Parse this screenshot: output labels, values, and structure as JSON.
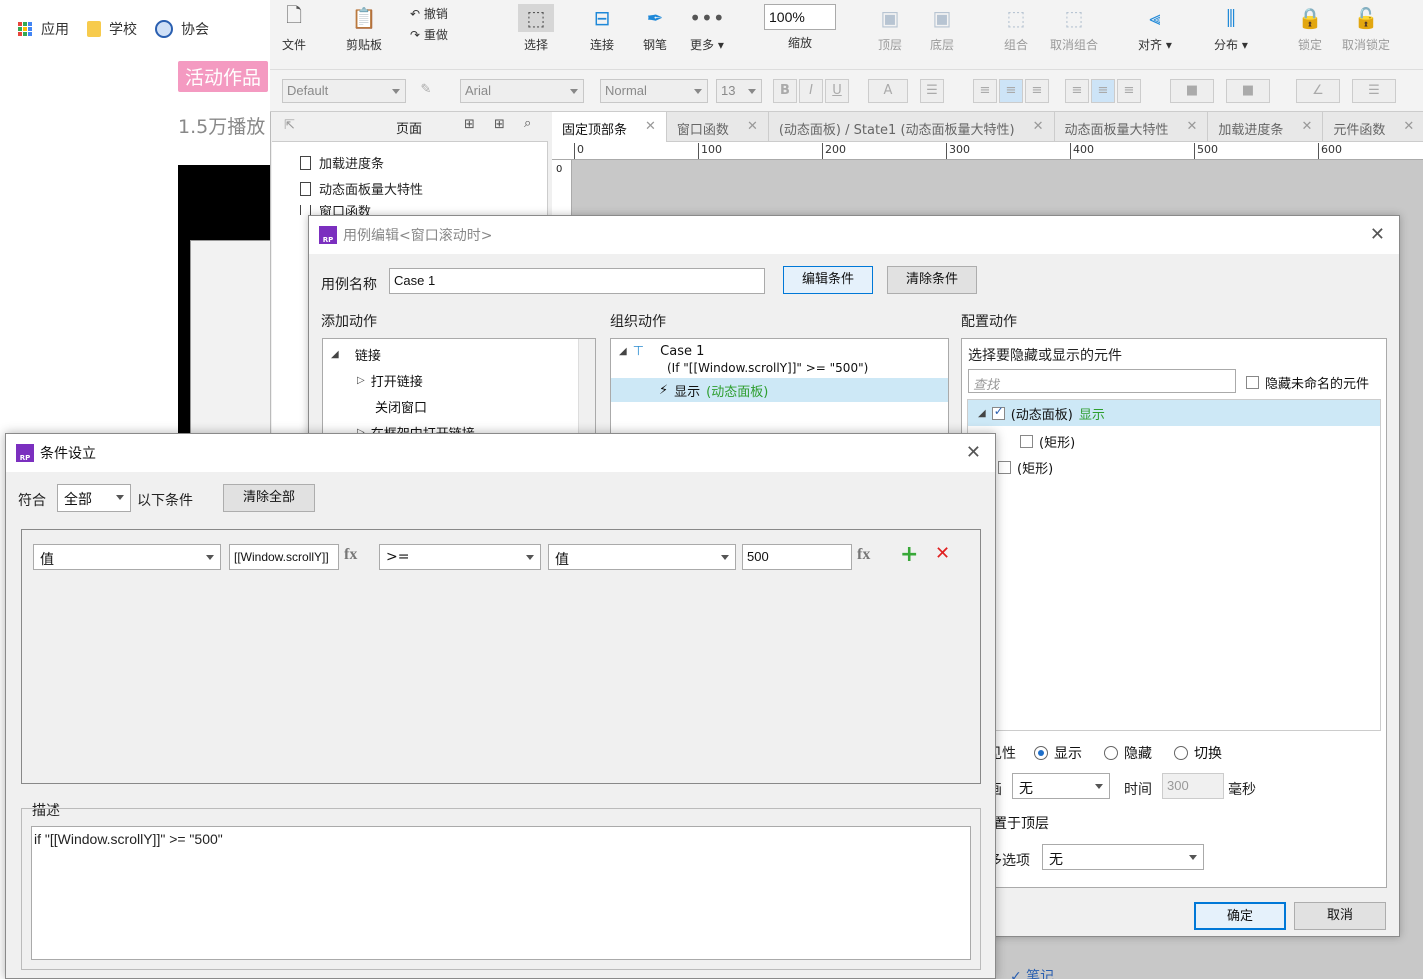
{
  "browser": {
    "bookmarks": [
      {
        "label": "应用"
      },
      {
        "label": "学校"
      },
      {
        "label": "协会"
      }
    ],
    "tag": "活动作品",
    "plays": "1.5万播放"
  },
  "toolbar": {
    "file": "文件",
    "clipboard": "剪贴板",
    "undo": "撤销",
    "redo": "重做",
    "select": "选择",
    "connect": "连接",
    "pen": "钢笔",
    "more": "更多 ▾",
    "zoom_value": "100%",
    "zoom": "缩放",
    "top": "顶层",
    "bottom": "底层",
    "group": "组合",
    "ungroup": "取消组合",
    "align": "对齐 ▾",
    "distribute": "分布 ▾",
    "lock": "锁定",
    "unlock": "取消锁定"
  },
  "formatbar": {
    "style": "Default",
    "font": "Arial",
    "weight": "Normal",
    "size": "13"
  },
  "pages": {
    "header": "页面",
    "items": [
      "加载进度条",
      "动态面板量大特性",
      "窗口函数"
    ]
  },
  "tabs": [
    "固定顶部条",
    "窗口函数",
    "(动态面板) / State1 (动态面板量大特性)",
    "动态面板量大特性",
    "加载进度条",
    "元件函数"
  ],
  "ruler": [
    "0",
    "100",
    "200",
    "300",
    "400",
    "500",
    "600"
  ],
  "vruler": "0",
  "case_editor": {
    "title": "用例编辑<窗口滚动时>",
    "case_name_label": "用例名称",
    "case_name": "Case 1",
    "edit_condition": "编辑条件",
    "clear_condition": "清除条件",
    "add_action": "添加动作",
    "organize_action": "组织动作",
    "config_action": "配置动作",
    "actions_tree": {
      "link": "链接",
      "open_link": "打开链接",
      "close_window": "关闭窗口",
      "open_in_frame": "在框架中打开链接"
    },
    "case_tree": {
      "case": "Case 1",
      "condition": "(If \"[[Window.scrollY]]\" >= \"500\")",
      "action": "显示",
      "action_target": "(动态面板)"
    },
    "config": {
      "choose_label": "选择要隐藏或显示的元件",
      "search_placeholder": "查找",
      "hide_unnamed": "隐藏未命名的元件",
      "widgets": [
        {
          "name": "(动态面板)",
          "status": "显示"
        },
        {
          "name": "(矩形)",
          "status": ""
        },
        {
          "name": "(矩形)",
          "status": ""
        }
      ],
      "visibility_label": "可见性",
      "show": "显示",
      "hide": "隐藏",
      "toggle": "切换",
      "animate_label": "动画",
      "animate_value": "无",
      "time_label": "时间",
      "time_value": "300",
      "ms": "毫秒",
      "bring_front": "置于顶层",
      "more_options_label": "更多选项",
      "more_options_value": "无"
    },
    "ok": "确定",
    "cancel": "取消"
  },
  "condition_dialog": {
    "title": "条件设立",
    "match_label": "符合",
    "match_value": "全部",
    "following": "以下条件",
    "clear_all": "清除全部",
    "row": {
      "left_type": "值",
      "left_value": "[[Window.scrollY]]",
      "operator": ">=",
      "right_type": "值",
      "right_value": "500"
    },
    "desc_label": "描述",
    "description": "if \"[[Window.scrollY]]\" >= \"500\""
  },
  "behind": {
    "annotate": "✓ 笔记"
  }
}
